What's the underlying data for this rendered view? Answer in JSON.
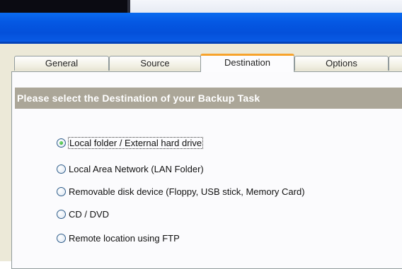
{
  "tabs": [
    {
      "label": "General",
      "active": false
    },
    {
      "label": "Source",
      "active": false
    },
    {
      "label": "Destination",
      "active": true
    },
    {
      "label": "Options",
      "active": false
    },
    {
      "label": "",
      "active": false
    }
  ],
  "section": {
    "header": "Please select the Destination of your Backup Task"
  },
  "destination_options": [
    {
      "label": "Local folder / External hard drive",
      "selected": true
    },
    {
      "label": "Local Area Network (LAN Folder)",
      "selected": false
    },
    {
      "label": "Removable disk device (Floppy, USB stick, Memory Card)",
      "selected": false
    },
    {
      "label": "CD / DVD",
      "selected": false
    },
    {
      "label": "Remote location using FTP",
      "selected": false
    }
  ],
  "colors": {
    "titlebar": "#0556e0",
    "dialog_bg": "#ece9d8",
    "section_header_bg": "#aba698",
    "active_tab_accent": "#f7a32c",
    "radio_dot": "#21a121"
  }
}
